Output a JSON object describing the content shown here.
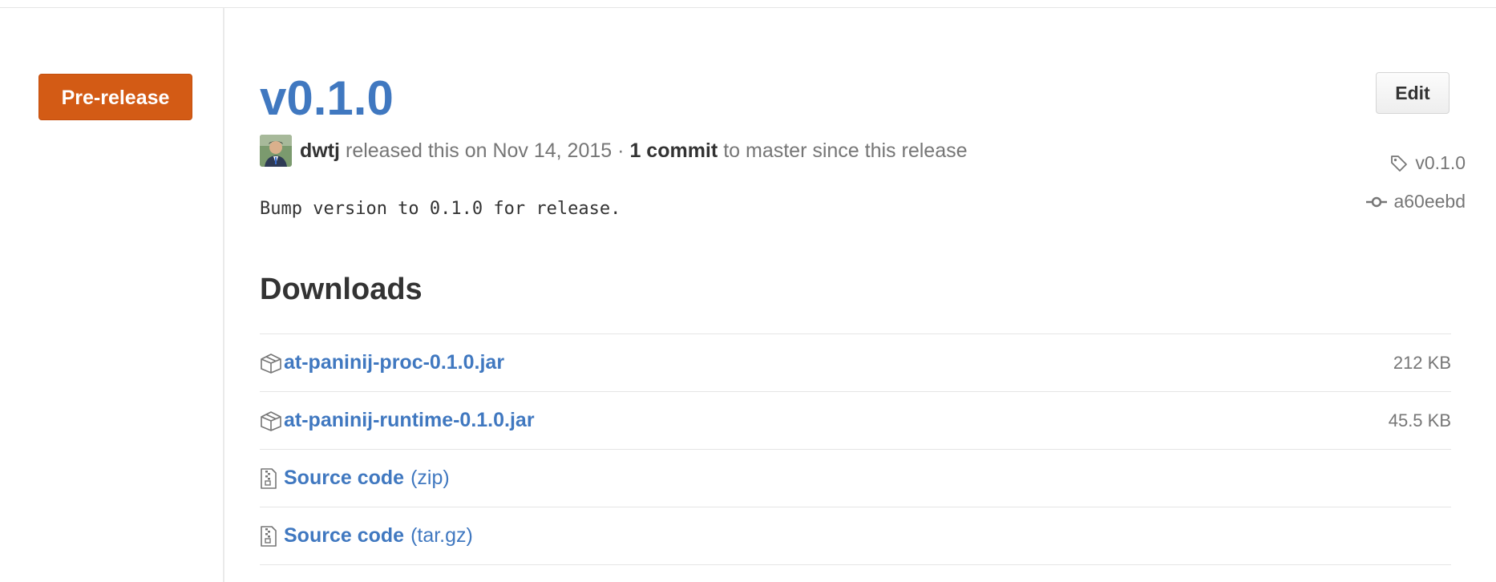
{
  "sidebar": {
    "badge_label": "Pre-release",
    "tag_label": "v0.1.0",
    "commit_label": "a60eebd"
  },
  "release": {
    "title": "v0.1.0",
    "edit_label": "Edit",
    "author": "dwtj",
    "released_text": "released this on Nov 14, 2015 ·",
    "commit_count": "1 commit",
    "since_text": "to master since this release",
    "body": "Bump version to 0.1.0 for release."
  },
  "downloads": {
    "heading": "Downloads",
    "items": [
      {
        "name": "at-paninij-proc-0.1.0.jar",
        "suffix": "",
        "size": "212 KB",
        "icon": "package-icon"
      },
      {
        "name": "at-paninij-runtime-0.1.0.jar",
        "suffix": "",
        "size": "45.5 KB",
        "icon": "package-icon"
      },
      {
        "name": "Source code",
        "suffix": "(zip)",
        "size": "",
        "icon": "file-zip-icon"
      },
      {
        "name": "Source code",
        "suffix": "(tar.gz)",
        "size": "",
        "icon": "file-zip-icon"
      }
    ]
  },
  "colors": {
    "link": "#4078c0",
    "prerelease": "#d35b15",
    "muted": "#767676"
  }
}
